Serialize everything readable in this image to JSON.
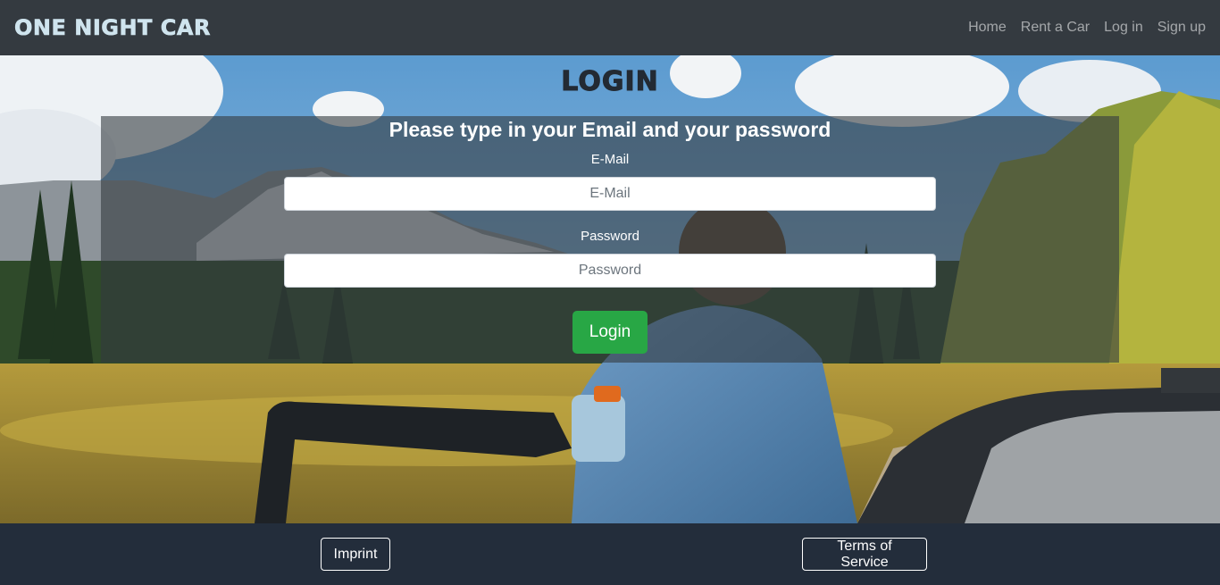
{
  "navbar": {
    "brand": "ONE NIGHT CAR",
    "links": [
      "Home",
      "Rent a Car",
      "Log in",
      "Sign up"
    ]
  },
  "page": {
    "title": "LOGIN"
  },
  "login_form": {
    "heading": "Please type in your Email and your password",
    "email_label": "E-Mail",
    "email_placeholder": "E-Mail",
    "email_value": "",
    "password_label": "Password",
    "password_placeholder": "Password",
    "password_value": "",
    "submit_label": "Login"
  },
  "footer": {
    "imprint_label": "Imprint",
    "terms_label": "Terms of Service"
  },
  "colors": {
    "navbar_bg": "#343a40",
    "footer_bg": "#232d3b",
    "login_button": "#28a745",
    "panel_overlay": "rgba(52,58,64,0.6)"
  }
}
